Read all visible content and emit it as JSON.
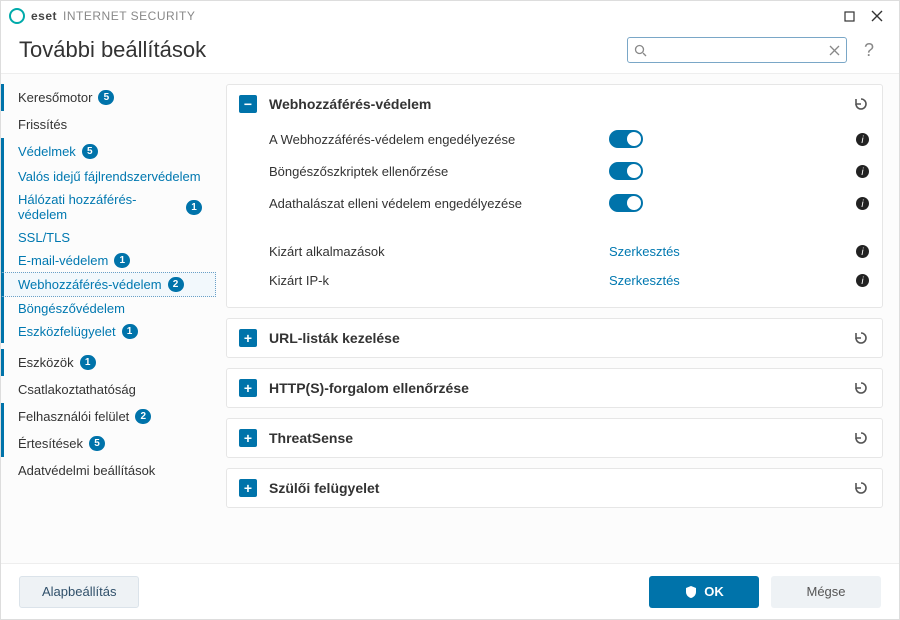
{
  "titlebar": {
    "brand": "eset",
    "product": "INTERNET SECURITY"
  },
  "header": {
    "title": "További beállítások",
    "search_placeholder": "",
    "help": "?"
  },
  "sidebar": {
    "detection_engine": {
      "label": "Keresőmotor",
      "badge": "5"
    },
    "update": {
      "label": "Frissítés"
    },
    "protections": {
      "label": "Védelmek",
      "badge": "5"
    },
    "realtime_fs": {
      "label": "Valós idejű fájlrendszervédelem"
    },
    "network_access": {
      "label": "Hálózati hozzáférés-védelem",
      "badge": "1"
    },
    "ssl_tls": {
      "label": "SSL/TLS"
    },
    "email_protection": {
      "label": "E-mail-védelem",
      "badge": "1"
    },
    "web_access": {
      "label": "Webhozzáférés-védelem",
      "badge": "2"
    },
    "browser_protection": {
      "label": "Böngészővédelem"
    },
    "device_control": {
      "label": "Eszközfelügyelet",
      "badge": "1"
    },
    "tools": {
      "label": "Eszközök",
      "badge": "1"
    },
    "connectivity": {
      "label": "Csatlakoztathatóság"
    },
    "ui": {
      "label": "Felhasználói felület",
      "badge": "2"
    },
    "notifications": {
      "label": "Értesítések",
      "badge": "5"
    },
    "privacy": {
      "label": "Adatvédelmi beállítások"
    }
  },
  "panels": {
    "web_access": {
      "title": "Webhozzáférés-védelem",
      "rows": [
        {
          "label": "A Webhozzáférés-védelem engedélyezése",
          "toggle": true
        },
        {
          "label": "Böngészőszkriptek ellenőrzése",
          "toggle": true
        },
        {
          "label": "Adathalászat elleni védelem engedélyezése",
          "toggle": true
        },
        {
          "label": "Kizárt alkalmazások",
          "action": "Szerkesztés"
        },
        {
          "label": "Kizárt IP-k",
          "action": "Szerkesztés"
        }
      ]
    },
    "url_lists": {
      "title": "URL-listák kezelése"
    },
    "https_traffic": {
      "title": "HTTP(S)-forgalom ellenőrzése"
    },
    "threatsense": {
      "title": "ThreatSense"
    },
    "parental": {
      "title": "Szülői felügyelet"
    }
  },
  "footer": {
    "default": "Alapbeállítás",
    "ok": "OK",
    "cancel": "Mégse"
  },
  "colors": {
    "accent": "#0073aa",
    "link": "#0078b0"
  }
}
